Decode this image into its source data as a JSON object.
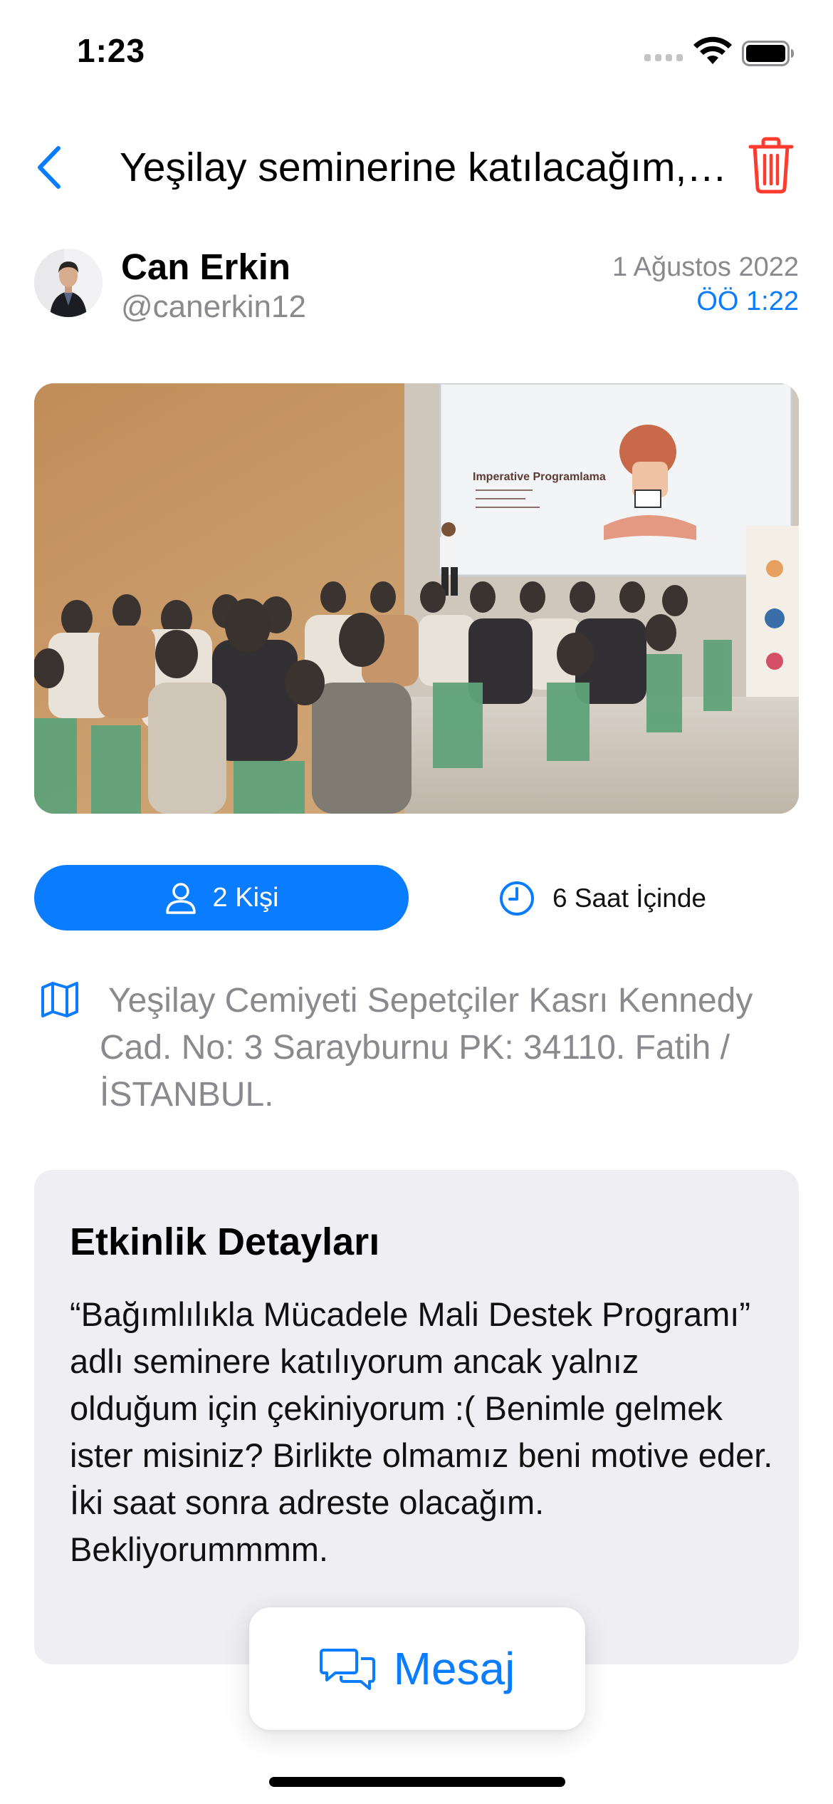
{
  "status_bar": {
    "time": "1:23"
  },
  "nav": {
    "title": "Yeşilay seminerine katılacağım, Benimle gelir misiniz?"
  },
  "author": {
    "name": "Can Erkin",
    "handle": "@canerkin12",
    "date": "1 Ağustos 2022",
    "time": "ÖÖ 1:22"
  },
  "event": {
    "people_label": "2 Kişi",
    "time_label": "6 Saat İçinde",
    "address": "Yeşilay Cemiyeti Sepetçiler Kasrı Kennedy Cad. No: 3 Sarayburnu PK: 34110. Fatih / İSTANBUL.",
    "slide_title": "Imperative Programlama"
  },
  "details": {
    "title": "Etkinlik Detayları",
    "body": "“Bağımlılıkla Mücadele Mali Destek Programı” adlı seminere katılıyorum ancak yalnız olduğum için çekiniyorum :( Benimle gelmek ister misiniz? Birlikte olmamız beni motive eder. İki saat sonra adreste olacağım. Bekliyorummmm."
  },
  "actions": {
    "message_label": "Mesaj"
  },
  "colors": {
    "accent": "#0a7cff",
    "danger": "#ff3b30",
    "card_bg": "#eeeef3",
    "secondary_text": "#8a8a8e"
  }
}
